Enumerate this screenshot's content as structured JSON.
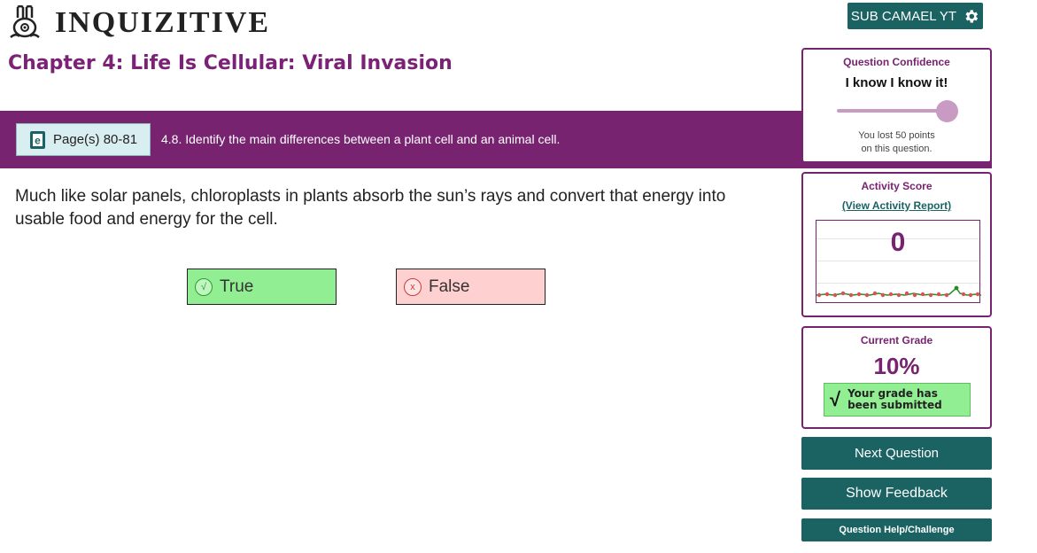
{
  "header": {
    "logo_text": "INQUIZITIVE",
    "logo_icon": "rabbit-icon",
    "user_label": "SUB CAMAEL YT",
    "settings_icon": "gear-icon"
  },
  "chapter": {
    "title": "Chapter 4: Life Is Cellular: Viral Invasion"
  },
  "objective_band": {
    "page_ref": "Page(s) 80-81",
    "page_icon": "ebook-icon",
    "objective": "4.8. Identify the main differences between a plant cell and an animal cell."
  },
  "question": {
    "text": "Much like solar panels, chloroplasts in plants absorb the sun’s rays and convert that energy into usable food and energy for the cell.",
    "answers": [
      {
        "label": "True",
        "mark": "√",
        "state": "correct",
        "color": "#92ee92"
      },
      {
        "label": "False",
        "mark": "x",
        "state": "incorrect",
        "color": "#ffd0d0"
      }
    ]
  },
  "confidence": {
    "title": "Question Confidence",
    "value": "I know I know it!",
    "slider_level": 1.0,
    "note_line1": "You lost 50 points",
    "note_line2": "on this question."
  },
  "activity": {
    "title": "Activity Score",
    "report_link": "(View Activity Report)",
    "score": "0"
  },
  "grade": {
    "title": "Current Grade",
    "value": "10%",
    "status_mark": "√",
    "status_line1": "Your grade has",
    "status_line2": "been submitted"
  },
  "actions": {
    "next": "Next Question",
    "feedback": "Show Feedback",
    "help": "Question Help/Challenge"
  },
  "colors": {
    "brand_purple": "#77236f",
    "brand_teal": "#1b6263",
    "correct_green": "#92ee92",
    "incorrect_pink": "#ffd0d0"
  }
}
